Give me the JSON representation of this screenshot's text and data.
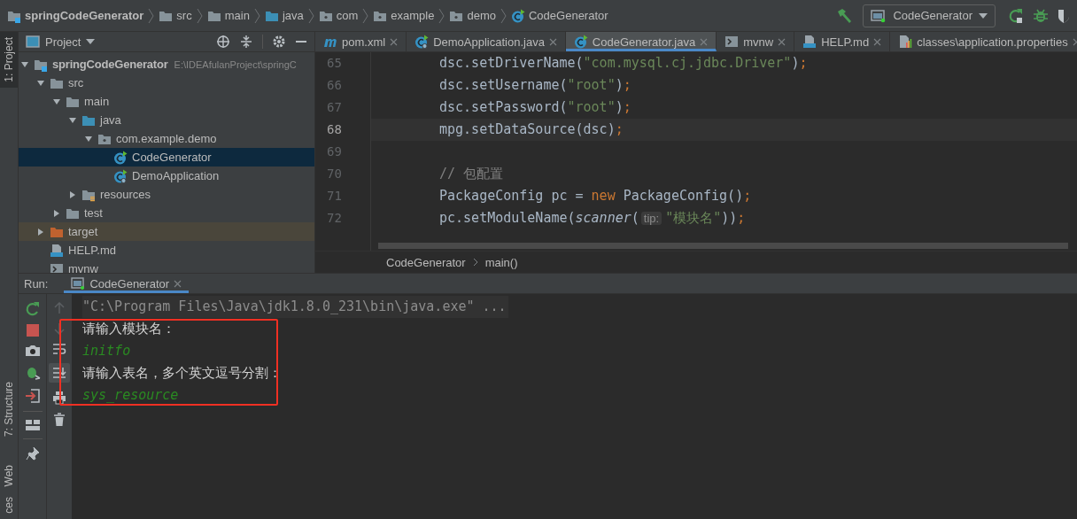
{
  "breadcrumb": [
    {
      "label": "springCodeGenerator",
      "kind": "module"
    },
    {
      "label": "src",
      "kind": "folder"
    },
    {
      "label": "main",
      "kind": "folder"
    },
    {
      "label": "java",
      "kind": "source"
    },
    {
      "label": "com",
      "kind": "package"
    },
    {
      "label": "example",
      "kind": "package"
    },
    {
      "label": "demo",
      "kind": "package"
    },
    {
      "label": "CodeGenerator",
      "kind": "class"
    }
  ],
  "toolbar": {
    "run_config": "CodeGenerator"
  },
  "side_tabs_top": [
    {
      "label": "1: Project",
      "selected": true
    }
  ],
  "side_tabs_bottom": [
    {
      "label": "7: Structure",
      "selected": false
    },
    {
      "label": "Web",
      "selected": false
    },
    {
      "label": "ces",
      "selected": false
    }
  ],
  "project_panel": {
    "title": "Project",
    "tree": [
      {
        "label": "springCodeGenerator",
        "path": "E:\\IDEAfulanProject\\springC",
        "kind": "module",
        "expanded": true,
        "selected": false,
        "children": [
          {
            "label": "src",
            "kind": "folder",
            "expanded": true,
            "selected": false,
            "children": [
              {
                "label": "main",
                "kind": "folder",
                "expanded": true,
                "selected": false,
                "children": [
                  {
                    "label": "java",
                    "kind": "source",
                    "expanded": true,
                    "selected": false,
                    "children": [
                      {
                        "label": "com.example.demo",
                        "kind": "package",
                        "expanded": true,
                        "selected": false,
                        "children": [
                          {
                            "label": "CodeGenerator",
                            "kind": "class",
                            "selected": true
                          },
                          {
                            "label": "DemoApplication",
                            "kind": "spring",
                            "selected": false
                          }
                        ]
                      }
                    ]
                  },
                  {
                    "label": "resources",
                    "kind": "resources",
                    "expanded": false,
                    "selected": false
                  }
                ]
              },
              {
                "label": "test",
                "kind": "folder",
                "expanded": false,
                "selected": false
              }
            ]
          },
          {
            "label": "target",
            "kind": "excluded",
            "expanded": false,
            "selected": false
          },
          {
            "label": "HELP.md",
            "kind": "md",
            "selected": false
          },
          {
            "label": "mvnw",
            "kind": "shell",
            "selected": false
          }
        ]
      }
    ]
  },
  "editor": {
    "tabs": [
      {
        "label": "pom.xml",
        "kind": "maven",
        "selected": false
      },
      {
        "label": "DemoApplication.java",
        "kind": "spring",
        "selected": false
      },
      {
        "label": "CodeGenerator.java",
        "kind": "class",
        "selected": true
      },
      {
        "label": "mvnw",
        "kind": "shell",
        "selected": false
      },
      {
        "label": "HELP.md",
        "kind": "md",
        "selected": false
      },
      {
        "label": "classes\\application.properties",
        "kind": "properties",
        "selected": false
      }
    ],
    "lines": [
      {
        "number": "65",
        "current": false,
        "tokens": [
          {
            "kind": "plain",
            "text": "dsc.setDriverName("
          },
          {
            "kind": "string",
            "text": "\"com.mysql.cj.jdbc.Driver\""
          },
          {
            "kind": "plain",
            "text": ")"
          },
          {
            "kind": "keyword",
            "text": ";"
          }
        ]
      },
      {
        "number": "66",
        "current": false,
        "tokens": [
          {
            "kind": "plain",
            "text": "dsc.setUsername("
          },
          {
            "kind": "string",
            "text": "\"root\""
          },
          {
            "kind": "plain",
            "text": ")"
          },
          {
            "kind": "keyword",
            "text": ";"
          }
        ]
      },
      {
        "number": "67",
        "current": false,
        "tokens": [
          {
            "kind": "plain",
            "text": "dsc.setPassword("
          },
          {
            "kind": "string",
            "text": "\"root\""
          },
          {
            "kind": "plain",
            "text": ")"
          },
          {
            "kind": "keyword",
            "text": ";"
          }
        ]
      },
      {
        "number": "68",
        "current": true,
        "tokens": [
          {
            "kind": "plain",
            "text": "mpg.setDataSource(dsc)"
          },
          {
            "kind": "keyword",
            "text": ";"
          }
        ]
      },
      {
        "number": "69",
        "current": false
      },
      {
        "number": "70",
        "current": false,
        "tokens": [
          {
            "kind": "comment",
            "text": "// 包配置"
          }
        ]
      },
      {
        "number": "71",
        "current": false,
        "tokens": [
          {
            "kind": "plain",
            "text": "PackageConfig pc = "
          },
          {
            "kind": "keyword",
            "text": "new"
          },
          {
            "kind": "plain",
            "text": " PackageConfig()"
          },
          {
            "kind": "keyword",
            "text": ";"
          }
        ]
      },
      {
        "number": "72",
        "current": false,
        "tokens": [
          {
            "kind": "plain",
            "text": "pc.setModuleName("
          },
          {
            "kind": "italic",
            "text": "scanner"
          },
          {
            "kind": "plain",
            "text": "("
          },
          {
            "kind": "hint",
            "text": "tip:"
          },
          {
            "kind": "string",
            "text": "\"模块名\""
          },
          {
            "kind": "plain",
            "text": "))"
          },
          {
            "kind": "keyword",
            "text": ";"
          }
        ]
      }
    ],
    "breadcrumb": [
      "CodeGenerator",
      "main()"
    ]
  },
  "run": {
    "label": "Run:",
    "tab": "CodeGenerator",
    "console": [
      {
        "kind": "command",
        "text": "\"C:\\Program Files\\Java\\jdk1.8.0_231\\bin\\java.exe\" ..."
      },
      {
        "kind": "output",
        "text": "请输入模块名："
      },
      {
        "kind": "input",
        "text": "initfo"
      },
      {
        "kind": "output",
        "text": "请输入表名，多个英文逗号分割："
      },
      {
        "kind": "input",
        "text": "sys_resource"
      }
    ]
  }
}
